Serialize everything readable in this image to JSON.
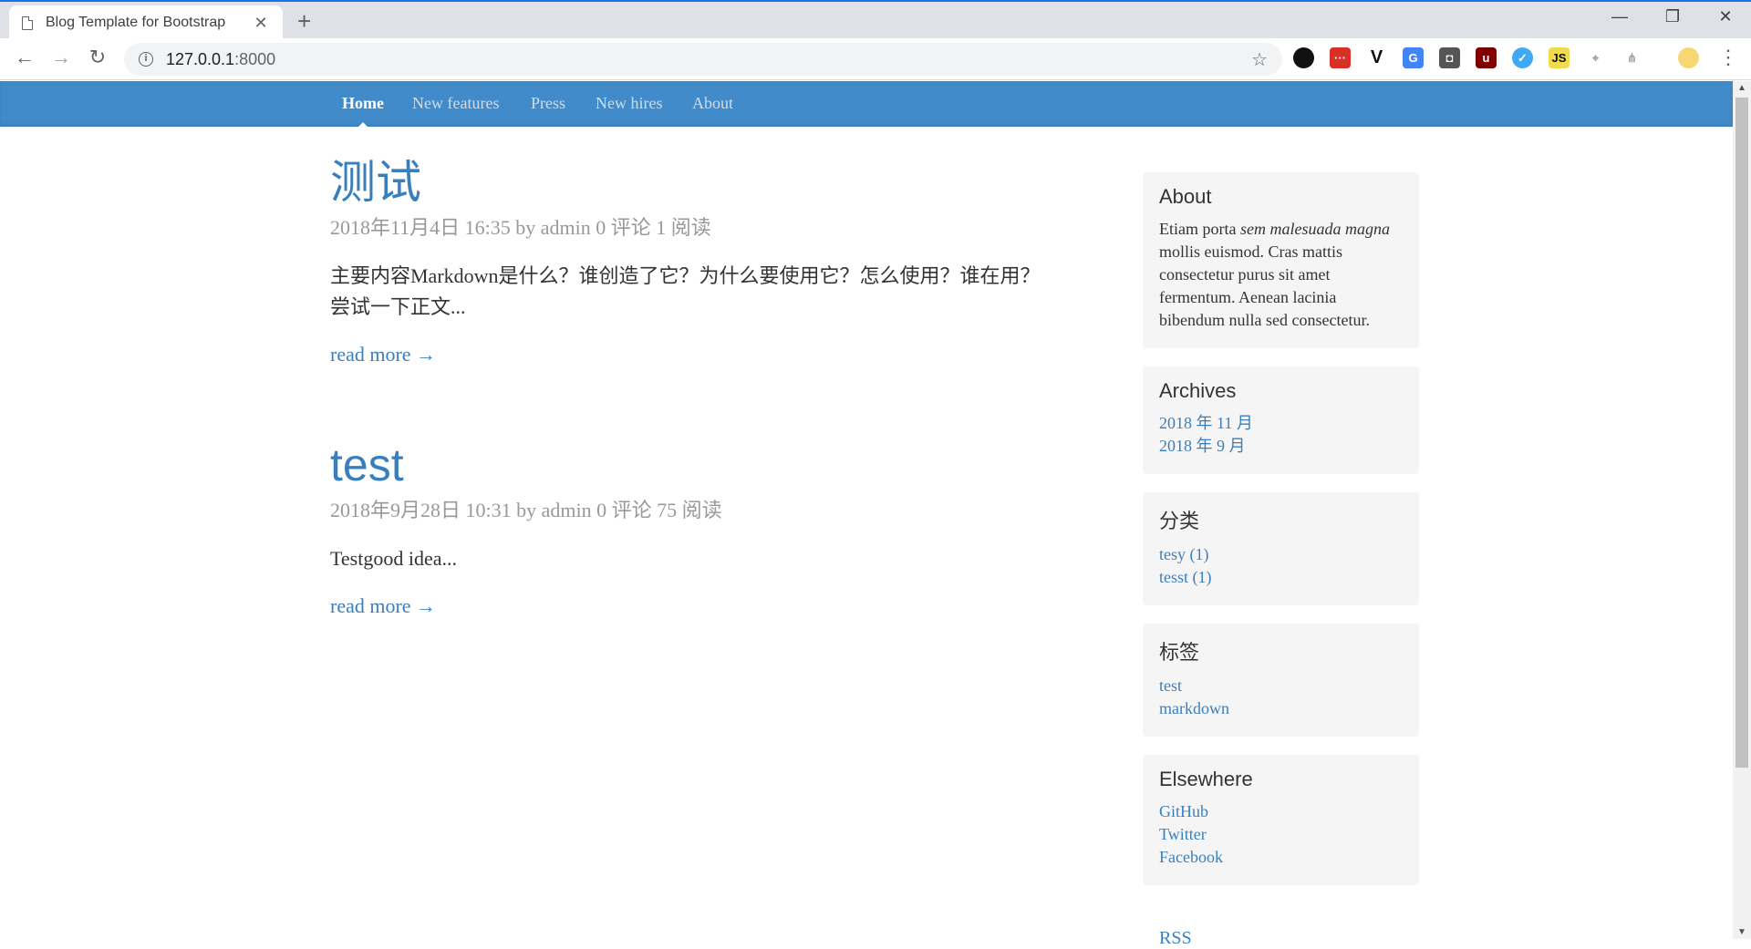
{
  "browser": {
    "tab_title": "Blog Template for Bootstrap",
    "tab_close": "✕",
    "new_tab": "+",
    "url_host": "127.0.0.1",
    "url_port": ":8000",
    "win_minimize": "—",
    "win_restore": "❐",
    "win_close": "✕"
  },
  "nav": {
    "items": [
      {
        "label": "Home",
        "active": true
      },
      {
        "label": "New features"
      },
      {
        "label": "Press"
      },
      {
        "label": "New hires"
      },
      {
        "label": "About"
      }
    ]
  },
  "posts": [
    {
      "title": "测试",
      "meta": "2018年11月4日 16:35 by admin 0 评论 1 阅读",
      "excerpt": "主要内容Markdown是什么？谁创造了它？为什么要使用它？怎么使用？谁在用？尝试一下正文...",
      "read_more": "read more →"
    },
    {
      "title": "test",
      "meta": "2018年9月28日 10:31 by admin 0 评论 75 阅读",
      "excerpt": "Testgood idea...",
      "read_more": "read more →"
    }
  ],
  "sidebar": {
    "about": {
      "title": "About",
      "text_1": "Etiam porta ",
      "text_em": "sem malesuada magna",
      "text_2": " mollis euismod. Cras mattis consectetur purus sit amet fermentum. Aenean lacinia bibendum nulla sed consectetur."
    },
    "archives": {
      "title": "Archives",
      "items": [
        "2018 年 11 月",
        "2018 年 9 月"
      ]
    },
    "categories": {
      "title": "分类",
      "items": [
        "tesy (1)",
        "tesst (1)"
      ]
    },
    "tags": {
      "title": "标签",
      "items": [
        "test",
        "markdown"
      ]
    },
    "elsewhere": {
      "title": "Elsewhere",
      "items": [
        "GitHub",
        "Twitter",
        "Facebook"
      ]
    }
  },
  "rss": "RSS"
}
